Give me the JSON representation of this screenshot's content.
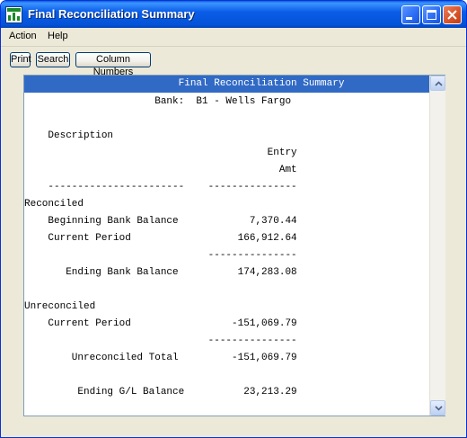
{
  "window": {
    "title": "Final Reconciliation Summary"
  },
  "menu": {
    "items": [
      "Action",
      "Help"
    ]
  },
  "toolbar": {
    "print": "Print",
    "search": "Search",
    "column_numbers": "Column Numbers"
  },
  "report": {
    "lines": [
      "                          Final Reconciliation Summary",
      "                      Bank:  B1 - Wells Fargo",
      "",
      "    Description",
      "                                         Entry",
      "                                           Amt",
      "    -----------------------    ---------------",
      "Reconciled",
      "    Beginning Bank Balance            7,370.44",
      "    Current Period                  166,912.64",
      "                               ---------------",
      "       Ending Bank Balance          174,283.08",
      "",
      "Unreconciled",
      "    Current Period                 -151,069.79",
      "                               ---------------",
      "        Unreconciled Total         -151,069.79",
      "",
      "         Ending G/L Balance          23,213.29"
    ]
  },
  "colors": {
    "titlebar": "#0453d8",
    "selection": "#316ac5",
    "window_bg": "#ece9d8"
  }
}
